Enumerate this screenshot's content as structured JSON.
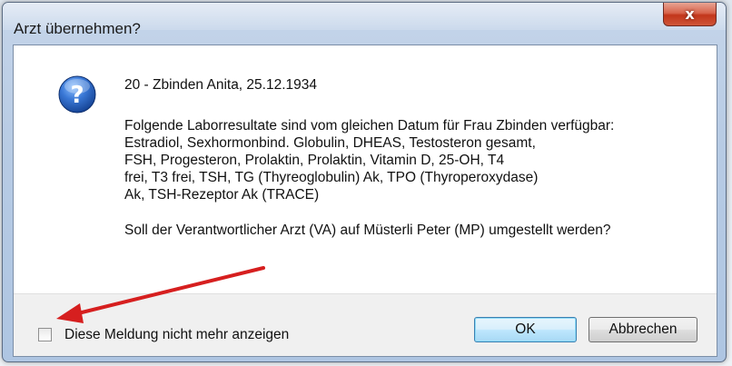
{
  "window": {
    "title": "Arzt übernehmen?",
    "close_label": "x"
  },
  "message": {
    "patient_line": "20 - Zbinden Anita, 25.12.1934",
    "lab_lines": [
      "Folgende Laborresultate sind vom gleichen Datum für Frau Zbinden verfügbar:",
      "Estradiol, Sexhormonbind. Globulin, DHEAS, Testosteron gesamt,",
      "FSH, Progesteron, Prolaktin, Prolaktin, Vitamin D, 25-OH, T4",
      "frei, T3 frei, TSH, TG (Thyreoglobulin) Ak, TPO (Thyroperoxydase)",
      "Ak, TSH-Rezeptor Ak (TRACE)"
    ],
    "question": "Soll der Verantwortlicher Arzt (VA) auf Müsterli Peter (MP) umgestellt werden?"
  },
  "footer": {
    "checkbox_label": "Diese Meldung nicht mehr anzeigen",
    "checkbox_checked": false,
    "ok_label": "OK",
    "cancel_label": "Abbrechen"
  },
  "icons": {
    "question": "question-icon",
    "close": "close-icon"
  },
  "colors": {
    "annotation_arrow": "#d61f1f",
    "icon_blue": "#2a5fb0"
  }
}
